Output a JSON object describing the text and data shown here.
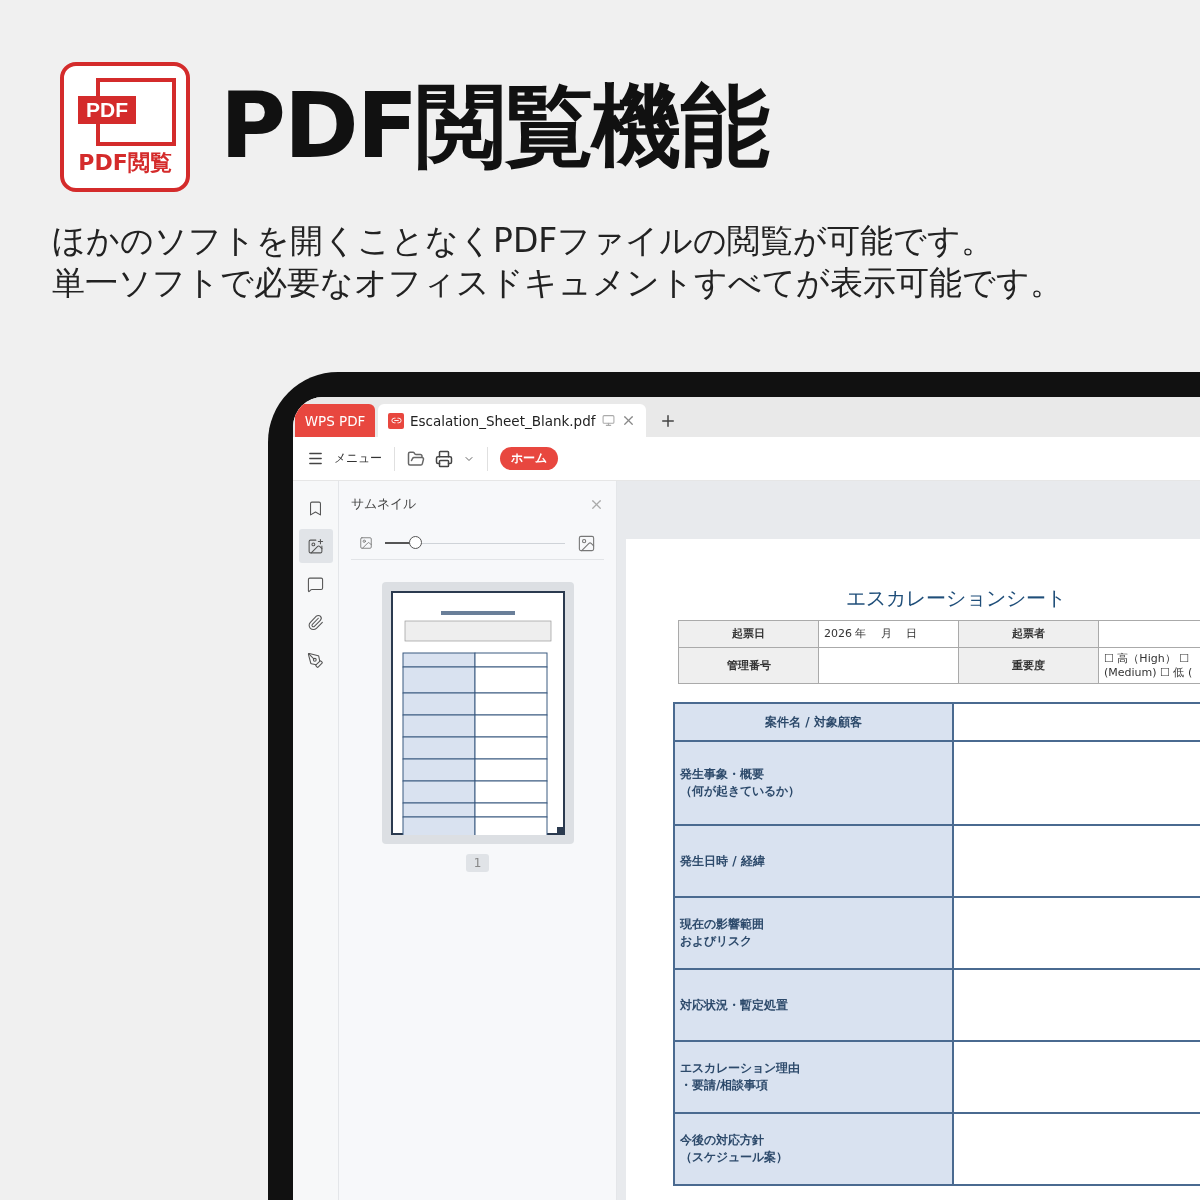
{
  "header": {
    "logo": {
      "badge": "PDF",
      "caption": "PDF閲覧"
    },
    "title": "PDF閲覧機能",
    "description": [
      "ほかのソフトを開くことなくPDFファイルの閲覧が可能です。",
      "単一ソフトで必要なオフィスドキュメントすべてが表示可能です。"
    ]
  },
  "app": {
    "tabs": [
      {
        "label": "WPS PDF",
        "kind": "home",
        "selected": false
      },
      {
        "label": "Escalation_Sheet_Blank.pdf",
        "kind": "document",
        "selected": true
      }
    ],
    "toolbar": {
      "menu": "メニュー",
      "home_button": "ホーム"
    },
    "side_rail": [
      {
        "kind": "bookmark",
        "selected": false
      },
      {
        "kind": "thumbnails",
        "selected": true
      },
      {
        "kind": "comment",
        "selected": false
      },
      {
        "kind": "attachment",
        "selected": false
      },
      {
        "kind": "sign",
        "selected": false
      }
    ],
    "thumbnail_panel": {
      "title": "サムネイル",
      "zoom": {
        "level": 0.17
      },
      "pages": [
        {
          "number": "1",
          "selected": true
        }
      ]
    },
    "document": {
      "title": "エスカレーションシート",
      "info_table": [
        [
          {
            "kind": "label",
            "text": "起票日"
          },
          {
            "kind": "value",
            "text": "2026 年　 月　 日"
          },
          {
            "kind": "label",
            "text": "起票者"
          },
          {
            "kind": "value"
          }
        ],
        [
          {
            "kind": "label",
            "text": "管理番号"
          },
          {
            "kind": "value"
          },
          {
            "kind": "label",
            "text": "重要度"
          },
          {
            "kind": "value",
            "text": "☐ 高（High） ☐\n(Medium) ☐ 低 ("
          }
        ]
      ],
      "main_rows": [
        {
          "kind": "heading",
          "lines": [
            "案件名 / 対象顧客"
          ]
        },
        {
          "kind": "field",
          "lines": [
            "発生事象・概要",
            "（何が起きているか）"
          ]
        },
        {
          "kind": "field",
          "lines": [
            "発生日時 / 経緯"
          ]
        },
        {
          "kind": "field",
          "lines": [
            "現在の影響範囲",
            "およびリスク"
          ]
        },
        {
          "kind": "field",
          "lines": [
            "対応状況・暫定処置"
          ]
        },
        {
          "kind": "field",
          "lines": [
            "エスカレーション理由",
            "・要請/相談事項"
          ]
        },
        {
          "kind": "field",
          "lines": [
            "今後の対応方針",
            "（スケジュール案）"
          ]
        }
      ]
    }
  }
}
